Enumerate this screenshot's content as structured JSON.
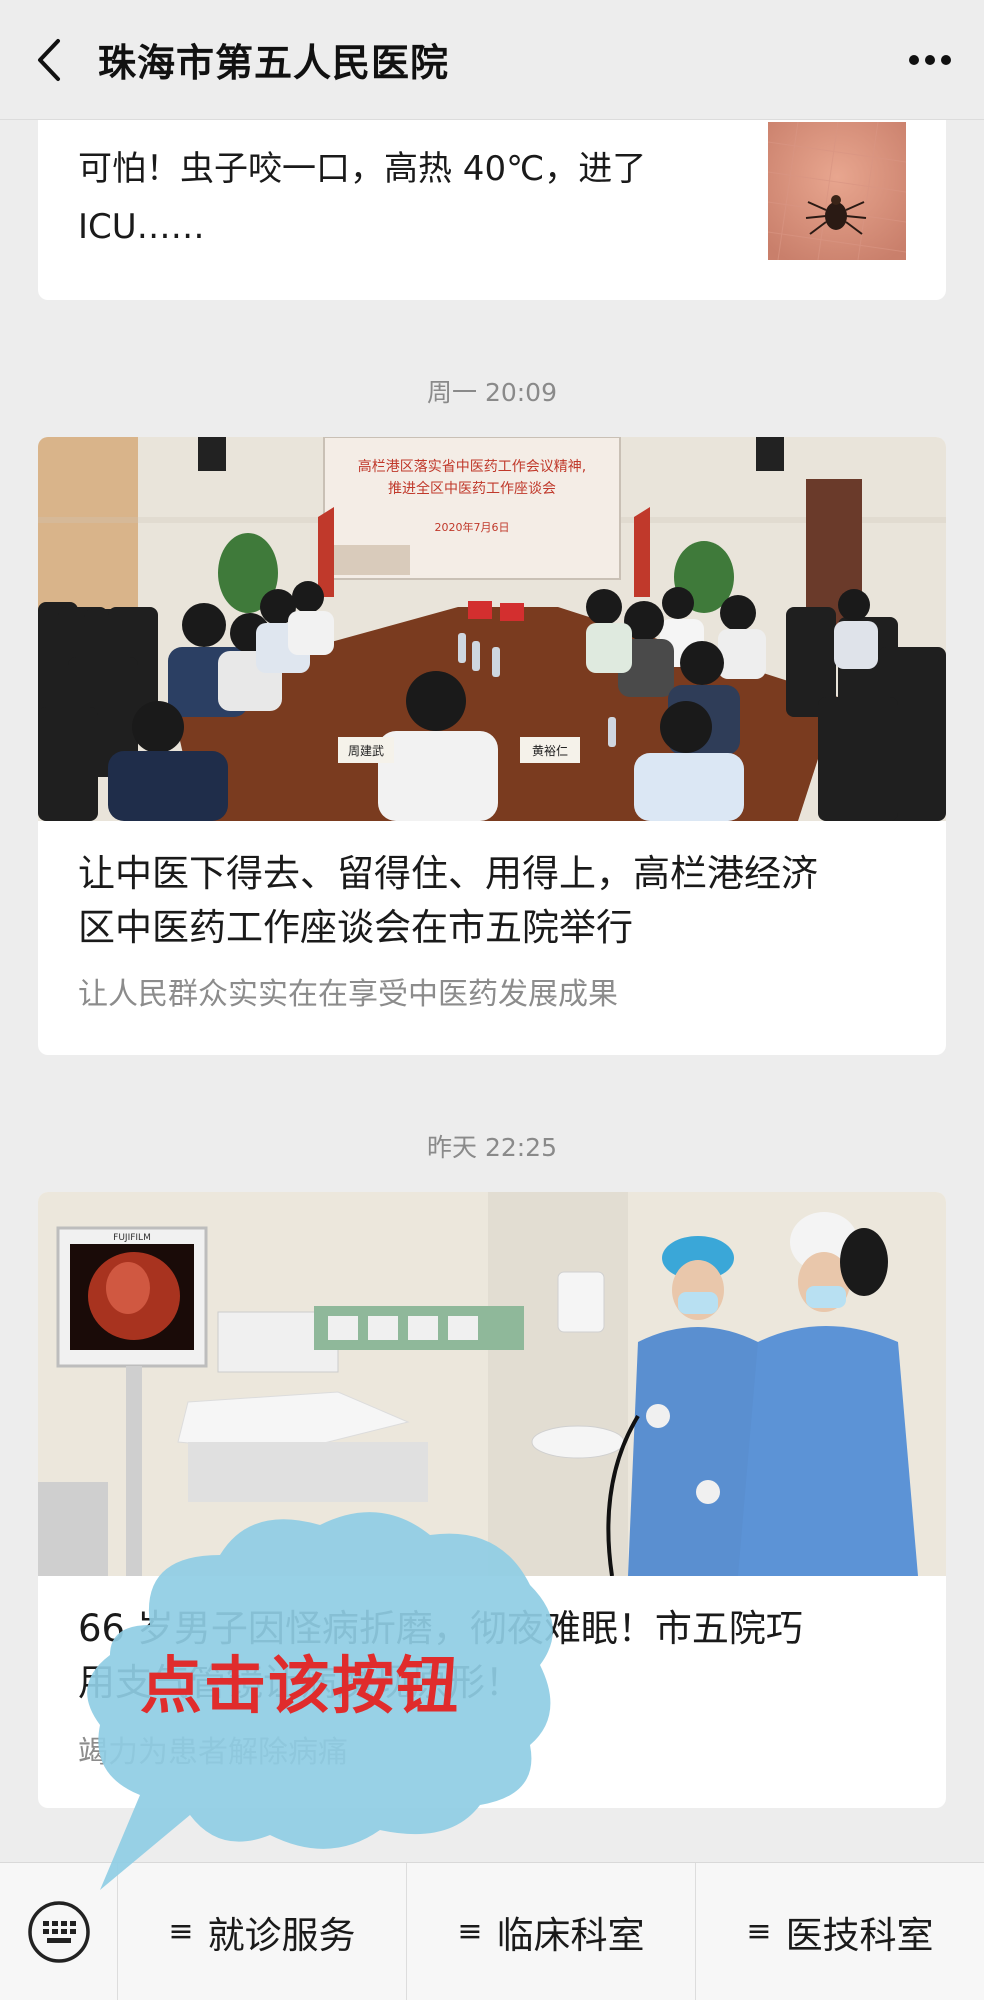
{
  "header": {
    "title": "珠海市第五人民医院"
  },
  "articles": [
    {
      "title_line1": "可怕！虫子咬一口，高热 40℃，进了",
      "title_line2": "ICU……"
    },
    {
      "timestamp": "周一 20:09",
      "title_line1": "让中医下得去、留得住、用得上，高栏港经济",
      "title_line2": "区中医药工作座谈会在市五院举行",
      "summary": "让人民群众实实在在享受中医药发展成果",
      "banner_line1": "高栏港区落实省中医药工作会议精神,",
      "banner_line2": "推进全区中医药工作座谈会",
      "banner_date": "2020年7月6日",
      "name_card_left": "周建武",
      "name_card_right": "黄裕仁"
    },
    {
      "timestamp": "昨天 22:25",
      "title_line1": "66 岁男子因怪病折磨，彻夜难眠！市五院巧",
      "title_line2": "用支气管镜让病魔现原形！",
      "summary": "竭力为患者解除病痛",
      "monitor_brand": "FUJIFILM"
    }
  ],
  "overlay": {
    "text": "点击该按钮"
  },
  "bottom_menu": {
    "items": [
      {
        "icon": "≡",
        "label": "就诊服务"
      },
      {
        "icon": "≡",
        "label": "临床科室"
      },
      {
        "icon": "≡",
        "label": "医技科室"
      }
    ]
  },
  "colors": {
    "background": "#ededed",
    "overlay_bubble": "#8fcde4",
    "overlay_text": "#e02c2c"
  }
}
